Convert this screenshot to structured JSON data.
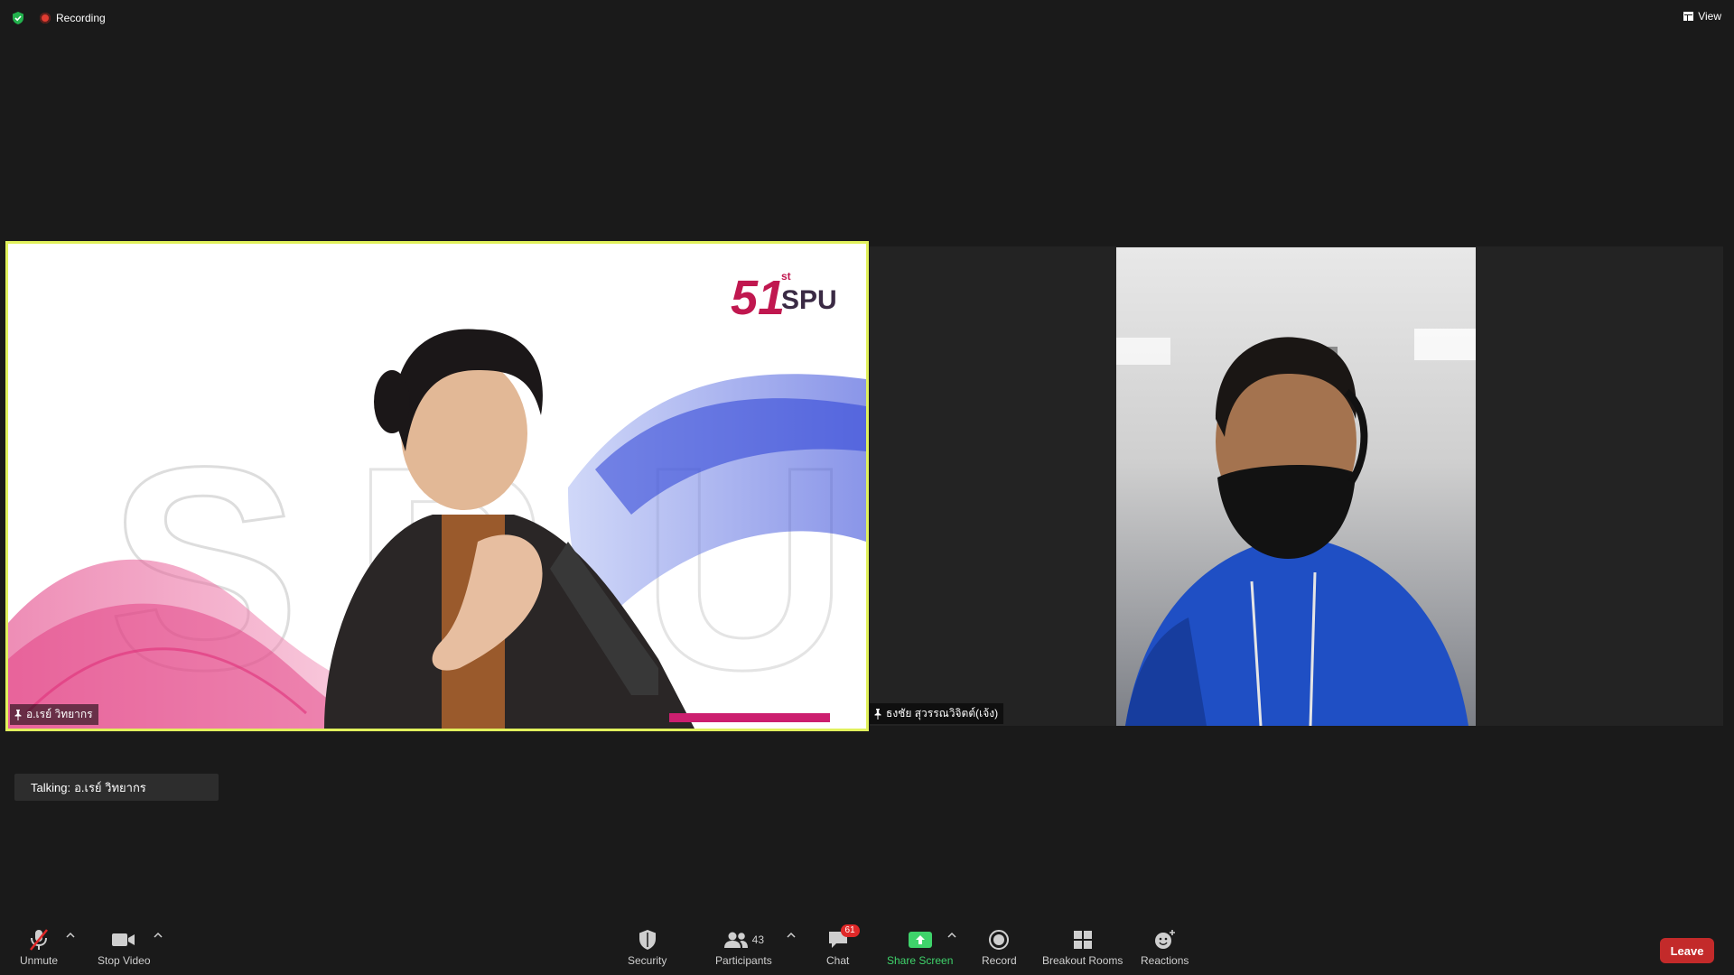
{
  "topbar": {
    "recording_label": "Recording",
    "view_label": "View"
  },
  "meeting": {
    "speaker_name": "อ.เรย์ วิทยากร",
    "participant2_name": "ธงชัย สุวรรณวิจิตต์(เจ้ง)",
    "talking_prefix": "Talking:",
    "talking_name": "อ.เรย์ วิทยากร",
    "speaker_bg_logo": "51 SPU",
    "speaker_bg_logo_sup": "st"
  },
  "toolbar": {
    "unmute_label": "Unmute",
    "stop_video_label": "Stop Video",
    "security_label": "Security",
    "participants_label": "Participants",
    "participants_count": "43",
    "chat_label": "Chat",
    "chat_badge": "61",
    "share_screen_label": "Share Screen",
    "record_label": "Record",
    "breakout_label": "Breakout Rooms",
    "reactions_label": "Reactions",
    "leave_label": "Leave"
  },
  "colors": {
    "background": "#1a1a1a",
    "active_speaker_border": "#e1f15c",
    "recording_red": "#e03c31",
    "share_green": "#3fd36b",
    "leave_red": "#c32a2a",
    "chat_badge_red": "#e02828",
    "security_shield_green": "#23b14d"
  }
}
